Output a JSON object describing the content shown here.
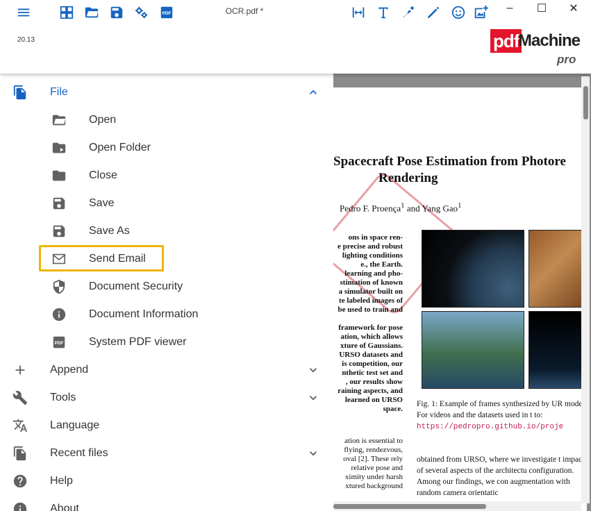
{
  "app": {
    "document_title": "OCR.pdf *",
    "version": "20.13",
    "logo": {
      "pdf": "pdf",
      "machine": "Machine",
      "pro": "pro"
    }
  },
  "toolbar_left": [
    "menu-icon",
    "apps-grid-icon",
    "open-folder-icon",
    "save-icon",
    "settings-icon",
    "pdf-icon"
  ],
  "toolbar_right": [
    "fit-width-icon",
    "text-icon",
    "draw-icon",
    "highlighter-icon",
    "emoji-icon",
    "add-image-icon"
  ],
  "window_controls": {
    "minimize": "–",
    "maximize": "☐",
    "close": "✕"
  },
  "menu": {
    "file": "File",
    "file_items": {
      "open": "Open",
      "open_folder": "Open Folder",
      "close": "Close",
      "save": "Save",
      "save_as": "Save As",
      "send_email": "Send Email",
      "document_security": "Document Security",
      "document_information": "Document Information",
      "system_pdf_viewer": "System PDF viewer"
    },
    "append": "Append",
    "tools": "Tools",
    "language": "Language",
    "recent_files": "Recent files",
    "help": "Help",
    "about": "About"
  },
  "document": {
    "title_line1": "Spacecraft Pose Estimation from Photore",
    "title_line2": "Rendering",
    "authors": "Pedro F. Proença",
    "authors_sup": "1",
    "authors_and": "and Yang Gao",
    "authors_sup2": "1",
    "abstract_lines": [
      "ons in space ren-",
      "e precise and robust",
      "lighting conditions",
      "e., the Earth.",
      "learning and pho-",
      "stimation of known",
      "a simulator built on",
      "te labeled images of",
      "be used to train and",
      "",
      "framework for pose",
      "ation, which allows",
      "xture of Gaussians.",
      "URSO datasets and",
      "is competition, our",
      "nthetic test set and",
      ", our results show",
      "raining aspects, and",
      "learned on URSO",
      "space."
    ],
    "body_lines": [
      "ation is essential to",
      "flying, rendezvous,",
      "oval [2]. These rely",
      "relative pose and",
      "ximity under harsh",
      "xtured background"
    ],
    "caption_text": "Fig. 1: Example of frames synthesized by UR model. For videos and the datasets used in t to:",
    "caption_link": "https://pedropro.github.io/proje",
    "right_text": "obtained from URSO, where we investigate t impact of several aspects of the architectu configuration. Among our findings, we con augmentation with random camera orientatic"
  }
}
